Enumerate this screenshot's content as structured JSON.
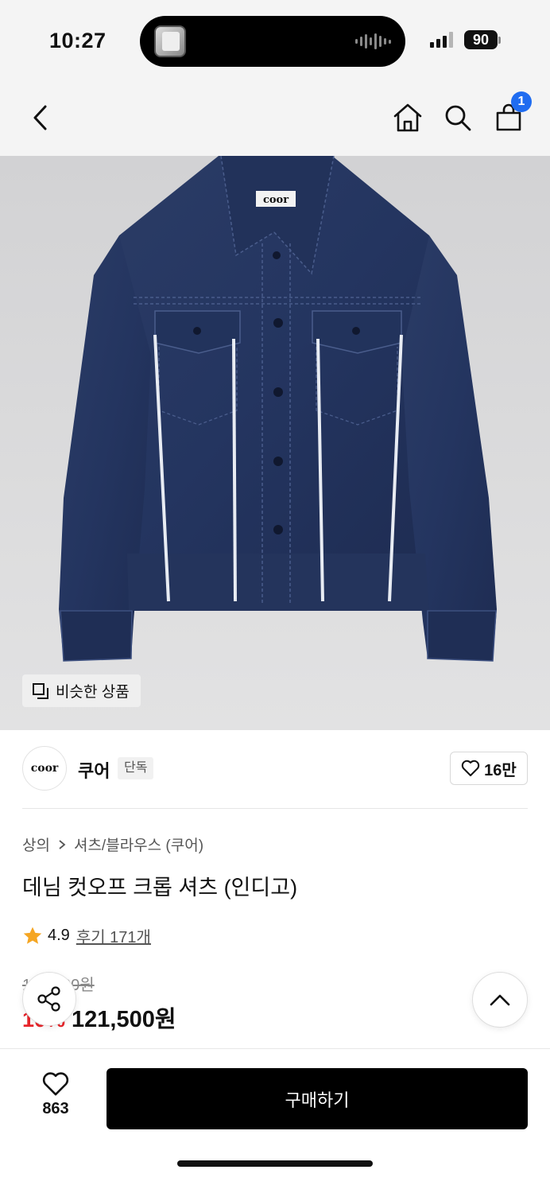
{
  "status_bar": {
    "time": "10:27",
    "battery": "90"
  },
  "nav": {
    "cart_count": "1",
    "icons": [
      "back-icon",
      "home-icon",
      "search-icon",
      "cart-icon"
    ]
  },
  "hero": {
    "jacket_label": "coor",
    "similar_button": "비슷한 상품"
  },
  "brand": {
    "logo_text": "coor",
    "name": "쿠어",
    "badge": "단독",
    "likes": "16만"
  },
  "product": {
    "breadcrumb": [
      "상의",
      "셔츠/블라우스 (쿠어)"
    ],
    "title": "데님 컷오프 크롭 셔츠 (인디고)",
    "rating": "4.9",
    "review_label": "후기 171개",
    "original_price": "135,000원",
    "discount": "10%",
    "price": "121,500원"
  },
  "bottom_bar": {
    "wish_count": "863",
    "buy_label": "구매하기"
  },
  "colors": {
    "accent_red": "#e8252b",
    "badge_blue": "#1f6cf0",
    "star": "#f5a623",
    "denim": "#26365e"
  }
}
